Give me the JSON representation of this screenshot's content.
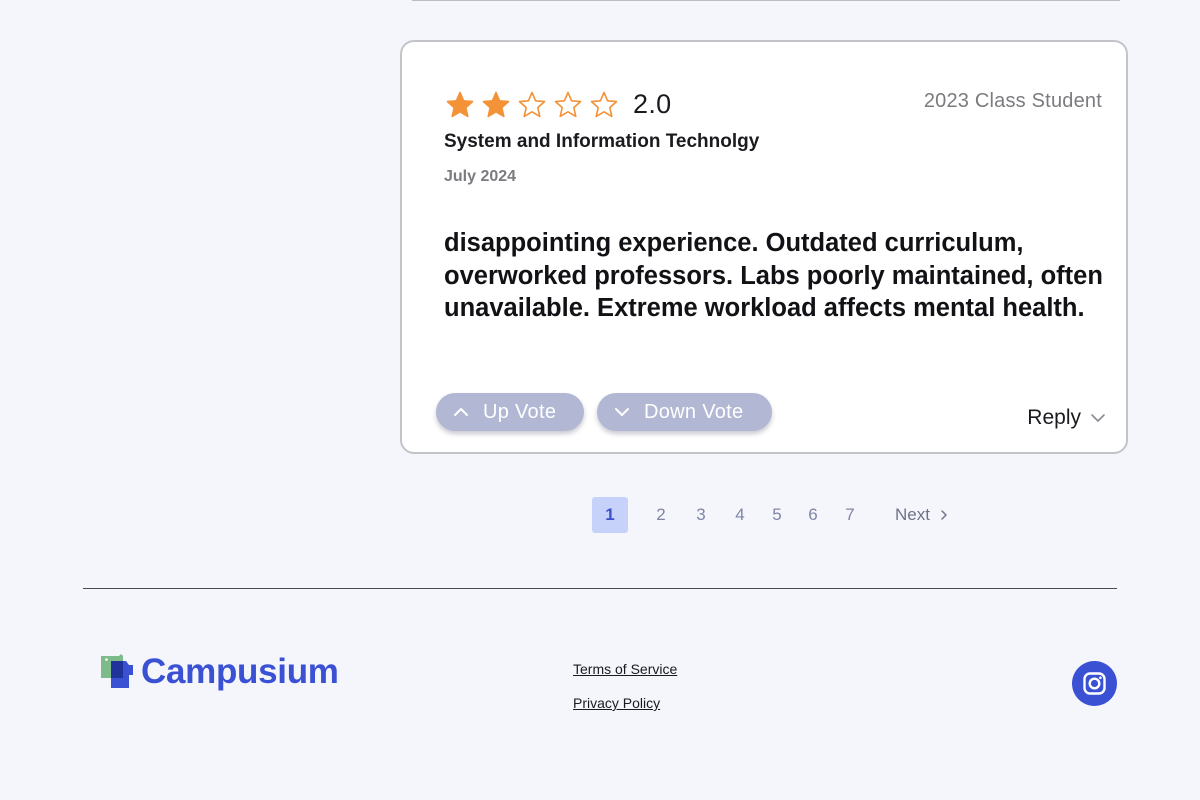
{
  "review": {
    "rating": 2,
    "max_rating": 5,
    "rating_label": "2.0",
    "reviewer_class": "2023 Class Student",
    "program": "System and Information Technolgy",
    "date": "July 2024",
    "body": "disappointing experience. Outdated curriculum, overworked professors. Labs poorly maintained, often unavailable. Extreme workload affects mental health.",
    "upvote_label": "Up Vote",
    "downvote_label": "Down Vote",
    "reply_label": "Reply"
  },
  "pagination": {
    "pages": [
      "1",
      "2",
      "3",
      "4",
      "5",
      "6",
      "7"
    ],
    "current": "1",
    "next_label": "Next"
  },
  "footer": {
    "brand": "Campusium",
    "terms_label": "Terms of Service",
    "privacy_label": "Privacy Policy",
    "social_icon": "instagram-icon"
  },
  "colors": {
    "star": "#f39237",
    "accent": "#3a51d4",
    "vote_button": "#b2b8d4",
    "active_page_bg": "#c7d2fb",
    "page_text": "#7f85a6"
  }
}
